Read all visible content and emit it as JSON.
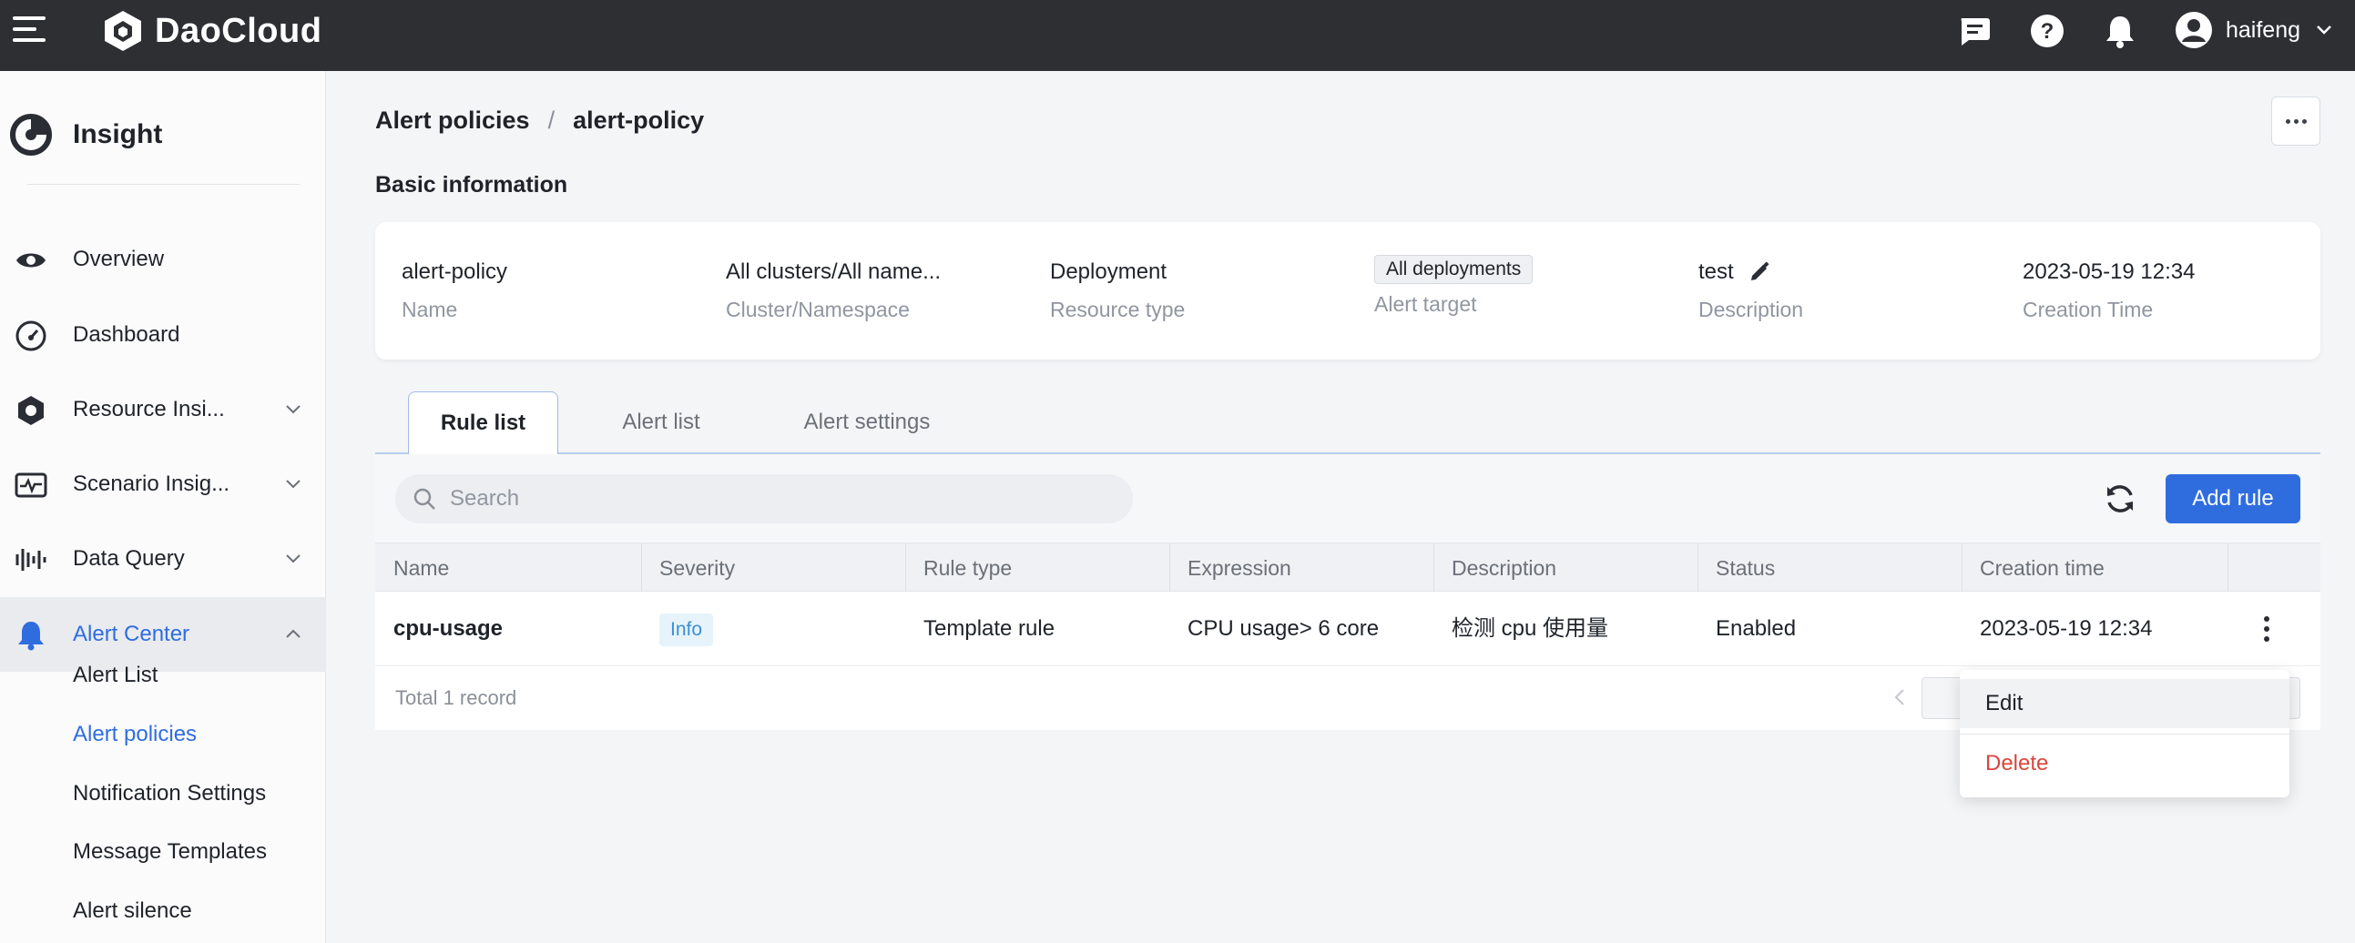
{
  "topbar": {
    "brand": "DaoCloud",
    "user_name": "haifeng"
  },
  "sidebar": {
    "title": "Insight",
    "items": [
      {
        "label": "Overview",
        "icon": "eye-icon"
      },
      {
        "label": "Dashboard",
        "icon": "gauge-icon"
      },
      {
        "label": "Resource Insi...",
        "icon": "hexagon-gear-icon"
      },
      {
        "label": "Scenario Insig...",
        "icon": "pulse-monitor-icon"
      },
      {
        "label": "Data Query",
        "icon": "waveform-icon"
      },
      {
        "label": "Alert Center",
        "icon": "bell-icon"
      }
    ],
    "sub_items": [
      {
        "label": "Alert List"
      },
      {
        "label": "Alert policies"
      },
      {
        "label": "Notification Settings"
      },
      {
        "label": "Message Templates"
      },
      {
        "label": "Alert silence"
      }
    ]
  },
  "breadcrumb": {
    "parent": "Alert policies",
    "separator": "/",
    "current": "alert-policy"
  },
  "basic_info": {
    "title": "Basic information",
    "fields": [
      {
        "value": "alert-policy",
        "label": "Name"
      },
      {
        "value": "All clusters/All name...",
        "label": "Cluster/Namespace"
      },
      {
        "value": "Deployment",
        "label": "Resource type"
      },
      {
        "value": "All deployments",
        "label": "Alert target"
      },
      {
        "value": "test",
        "label": "Description"
      },
      {
        "value": "2023-05-19 12:34",
        "label": "Creation Time"
      }
    ]
  },
  "tabs": [
    {
      "label": "Rule list"
    },
    {
      "label": "Alert list"
    },
    {
      "label": "Alert settings"
    }
  ],
  "toolbar": {
    "search_placeholder": "Search",
    "add_label": "Add rule"
  },
  "table": {
    "columns": [
      "Name",
      "Severity",
      "Rule type",
      "Expression",
      "Description",
      "Status",
      "Creation time"
    ],
    "rows": [
      {
        "name": "cpu-usage",
        "severity": "Info",
        "rule_type": "Template rule",
        "expression": "CPU usage> 6 core",
        "description": "检测 cpu 使用量",
        "status": "Enabled",
        "created": "2023-05-19 12:34"
      }
    ],
    "total": "Total 1 record"
  },
  "row_menu": {
    "edit": "Edit",
    "delete": "Delete"
  },
  "colors": {
    "accent": "#2f6ddf",
    "topbar": "#2e2f33",
    "danger": "#d9463e"
  }
}
